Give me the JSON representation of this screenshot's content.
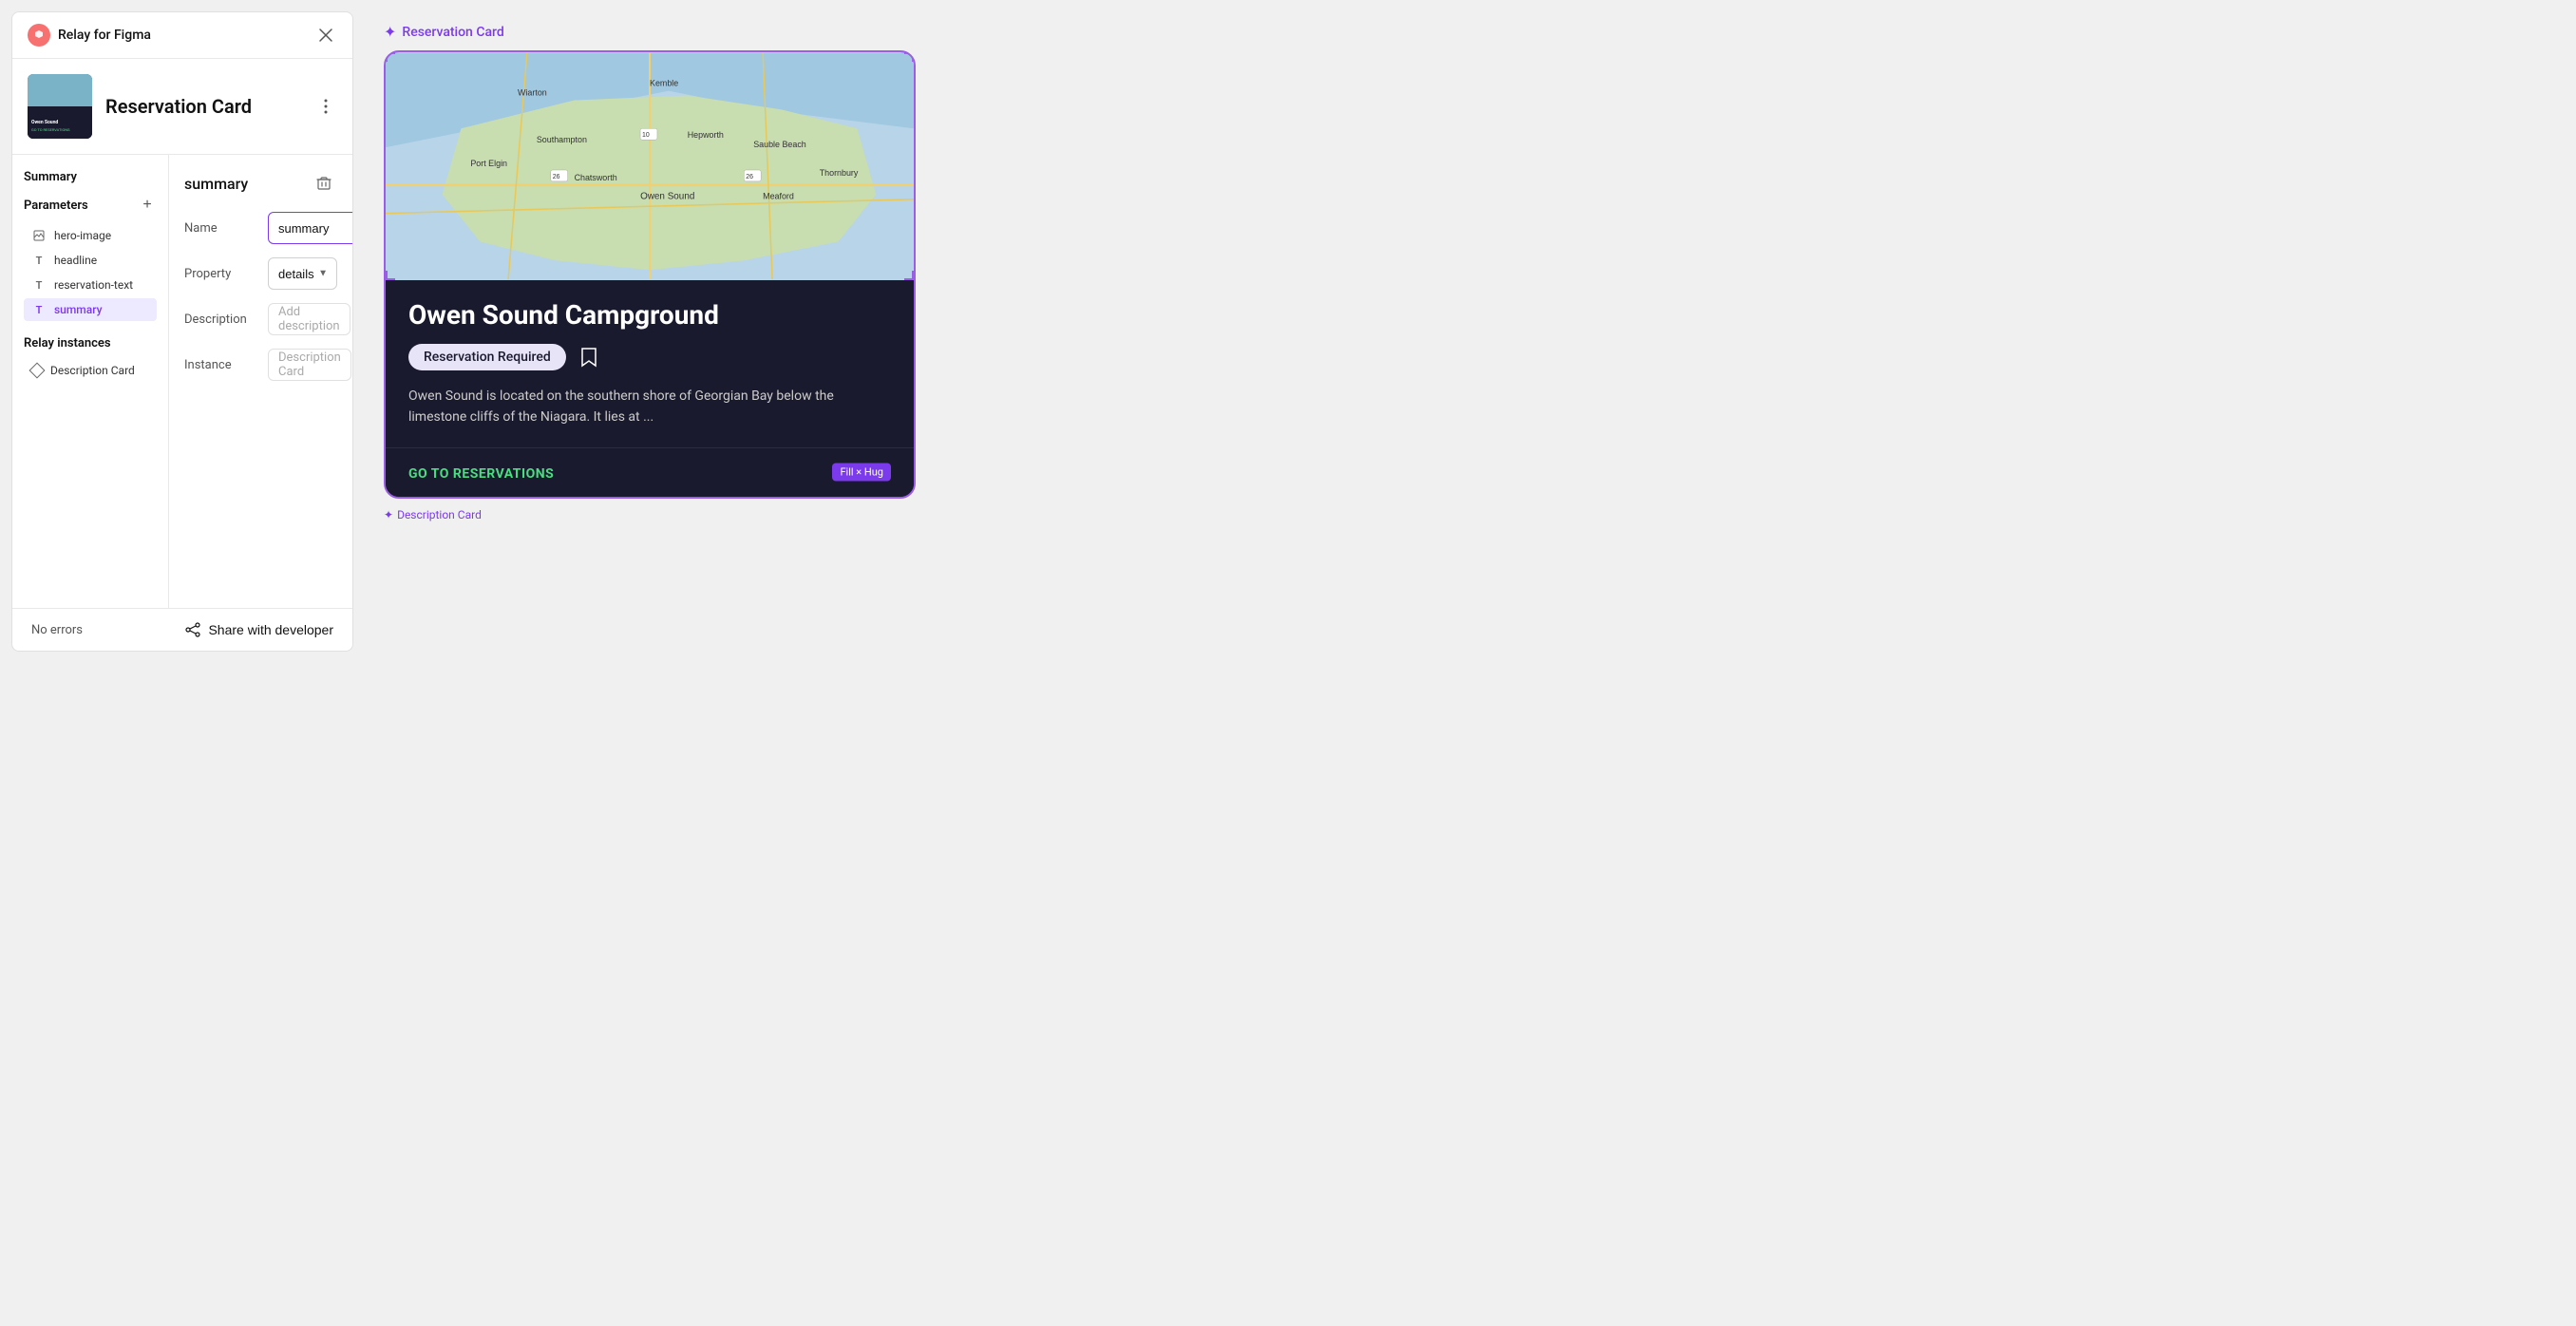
{
  "app": {
    "title": "Relay for Figma",
    "close_label": "×"
  },
  "component": {
    "name": "Reservation Card",
    "thumbnail_alt": "Reservation Card thumbnail"
  },
  "sidebar": {
    "summary_label": "Summary",
    "parameters_label": "Parameters",
    "add_label": "+",
    "params": [
      {
        "id": "hero-image",
        "icon": "image",
        "label": "hero-image",
        "active": false
      },
      {
        "id": "headline",
        "icon": "T",
        "label": "headline",
        "active": false
      },
      {
        "id": "reservation-text",
        "icon": "T",
        "label": "reservation-text",
        "active": false
      },
      {
        "id": "summary",
        "icon": "T",
        "label": "summary",
        "active": true
      }
    ],
    "relay_instances_label": "Relay instances",
    "instances": [
      {
        "id": "description-card",
        "label": "Description Card"
      }
    ]
  },
  "form": {
    "section_title": "summary",
    "name_label": "Name",
    "name_value": "summary",
    "property_label": "Property",
    "property_value": "details",
    "description_label": "Description",
    "description_placeholder": "Add description",
    "instance_label": "Instance",
    "instance_value": "Description Card"
  },
  "footer": {
    "no_errors": "No errors",
    "share_label": "Share with developer"
  },
  "preview": {
    "label": "Reservation Card",
    "card": {
      "title": "Owen Sound Campground",
      "tag": "Reservation Required",
      "description": "Owen Sound is located on the southern shore of Georgian Bay below the limestone cliffs of the Niagara. It lies at ...",
      "cta": "GO TO RESERVATIONS",
      "fill_hug": "Fill × Hug"
    },
    "description_card_label": "Description Card"
  }
}
